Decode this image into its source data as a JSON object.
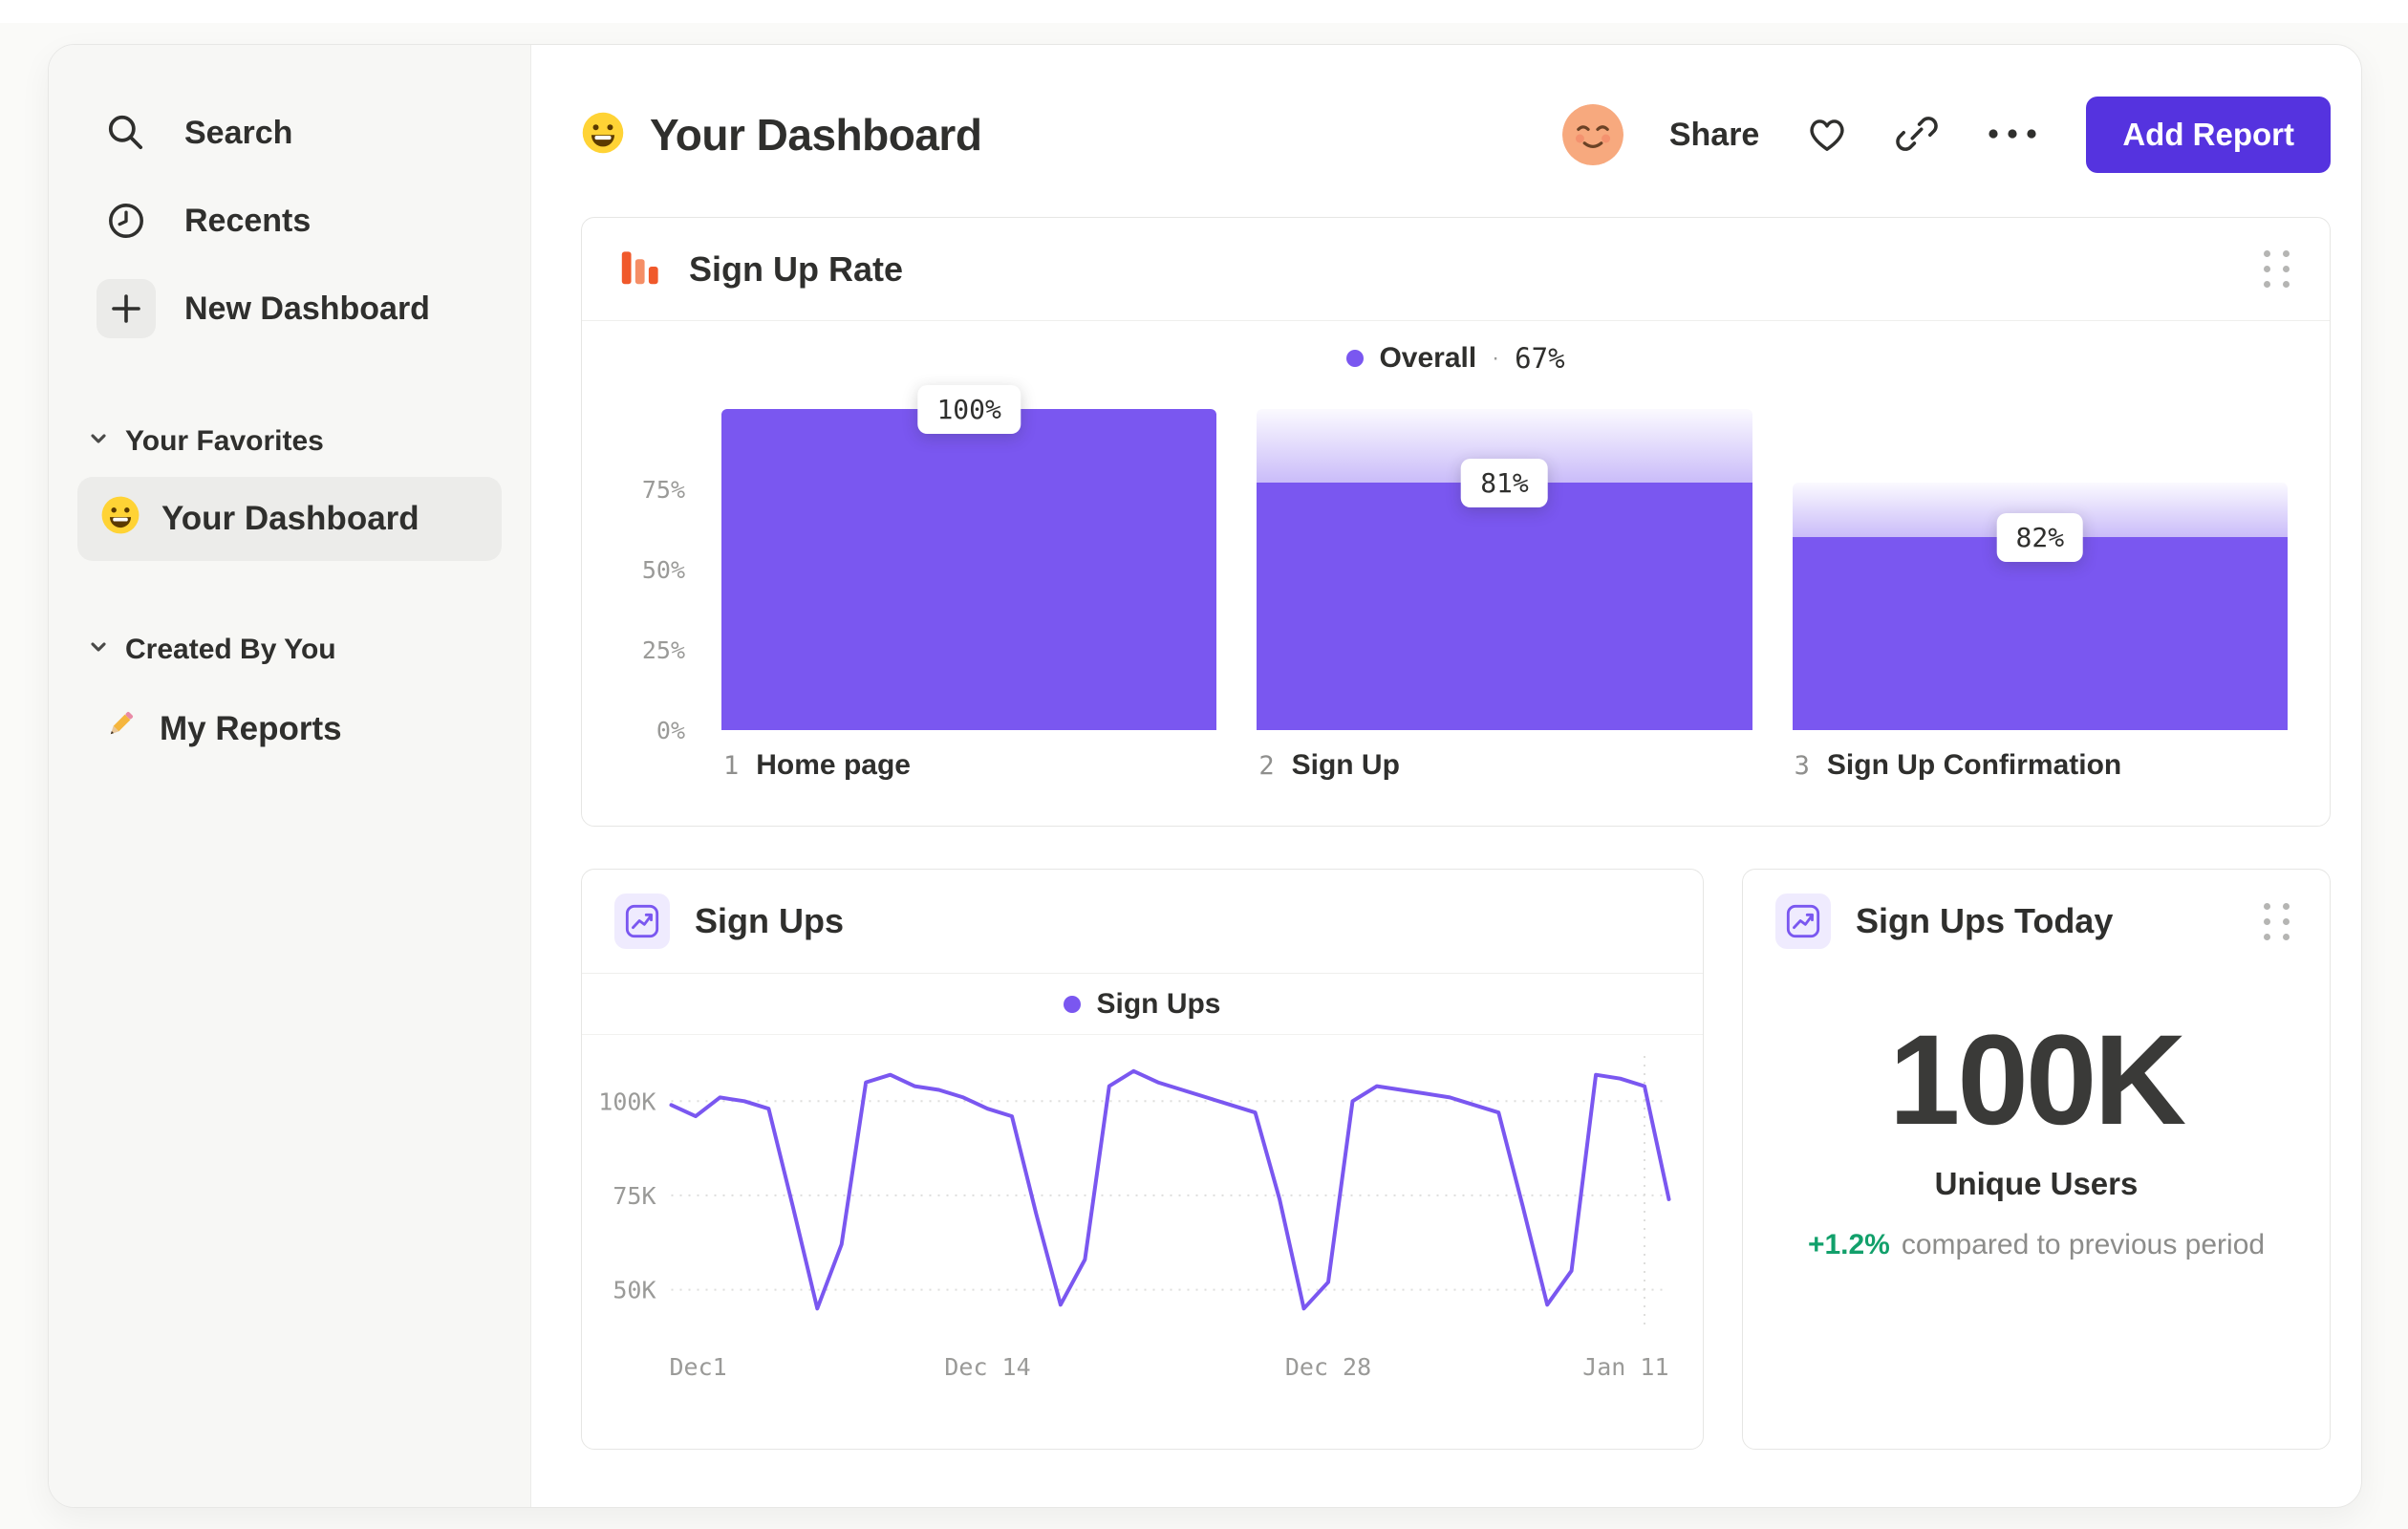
{
  "colors": {
    "accent_purple": "#7A57F0",
    "button_purple": "#5533DF",
    "funnel_icon_orange": "#F0592B",
    "positive_green": "#12A06B",
    "sidebar_bg": "#F7F7F5",
    "page_bg": "#FAFAF8"
  },
  "sidebar": {
    "nav": [
      {
        "label": "Search",
        "icon": "search-icon"
      },
      {
        "label": "Recents",
        "icon": "clock-icon"
      },
      {
        "label": "New Dashboard",
        "icon": "plus-icon"
      }
    ],
    "sections": [
      {
        "title": "Your Favorites",
        "items": [
          {
            "label": "Your Dashboard",
            "icon": "smiley-emoji-icon",
            "selected": true
          }
        ]
      },
      {
        "title": "Created By You",
        "items": [
          {
            "label": "My Reports",
            "icon": "pencil-emoji-icon",
            "selected": false
          }
        ]
      }
    ]
  },
  "header": {
    "title": "Your Dashboard",
    "share": "Share",
    "add_report": "Add Report"
  },
  "chart_data": [
    {
      "type": "bar",
      "id": "sign-up-rate-funnel",
      "title": "Sign Up Rate",
      "legend_label": "Overall",
      "legend_sep": "·",
      "legend_value": "67%",
      "categories": [
        "Home page",
        "Sign Up",
        "Sign Up Confirmation"
      ],
      "step_numbers": [
        "1",
        "2",
        "3"
      ],
      "values": [
        100,
        81,
        82
      ],
      "value_labels": [
        "100%",
        "81%",
        "82%"
      ],
      "rendered_fill_pct": [
        100,
        77,
        60
      ],
      "rendered_cap_pct": [
        100,
        100,
        77
      ],
      "y_ticks": [
        "75%",
        "50%",
        "25%",
        "0%"
      ],
      "ylim": [
        0,
        100
      ],
      "bar_color": "#7A57F0"
    },
    {
      "type": "line",
      "id": "sign-ups-line",
      "title": "Sign Ups",
      "legend_label": "Sign Ups",
      "series": [
        {
          "name": "Sign Ups",
          "values_thousands": [
            99,
            96,
            101,
            100,
            98,
            72,
            45,
            62,
            105,
            107,
            104,
            103,
            101,
            98,
            96,
            70,
            46,
            58,
            104,
            108,
            105,
            103,
            101,
            99,
            97,
            74,
            45,
            52,
            100,
            104,
            103,
            102,
            101,
            99,
            97,
            72,
            46,
            55,
            107,
            106,
            104,
            74
          ]
        }
      ],
      "x_tick_labels": [
        "Dec1",
        "Dec 14",
        "Dec 28",
        "Jan 11"
      ],
      "x_tick_indices": [
        0,
        13,
        27,
        41
      ],
      "y_tick_labels": [
        "100K",
        "75K",
        "50K"
      ],
      "y_ticks_thousands": [
        100,
        75,
        50
      ],
      "ylim_thousands": [
        40,
        112
      ],
      "today_marker_index": 40,
      "line_color": "#7A57F0",
      "grid": "dashed-horizontal"
    },
    {
      "type": "big_number",
      "id": "sign-ups-today",
      "title": "Sign Ups Today",
      "value": "100K",
      "label": "Unique Users",
      "delta": "+1.2%",
      "delta_note": "compared to previous period"
    }
  ]
}
